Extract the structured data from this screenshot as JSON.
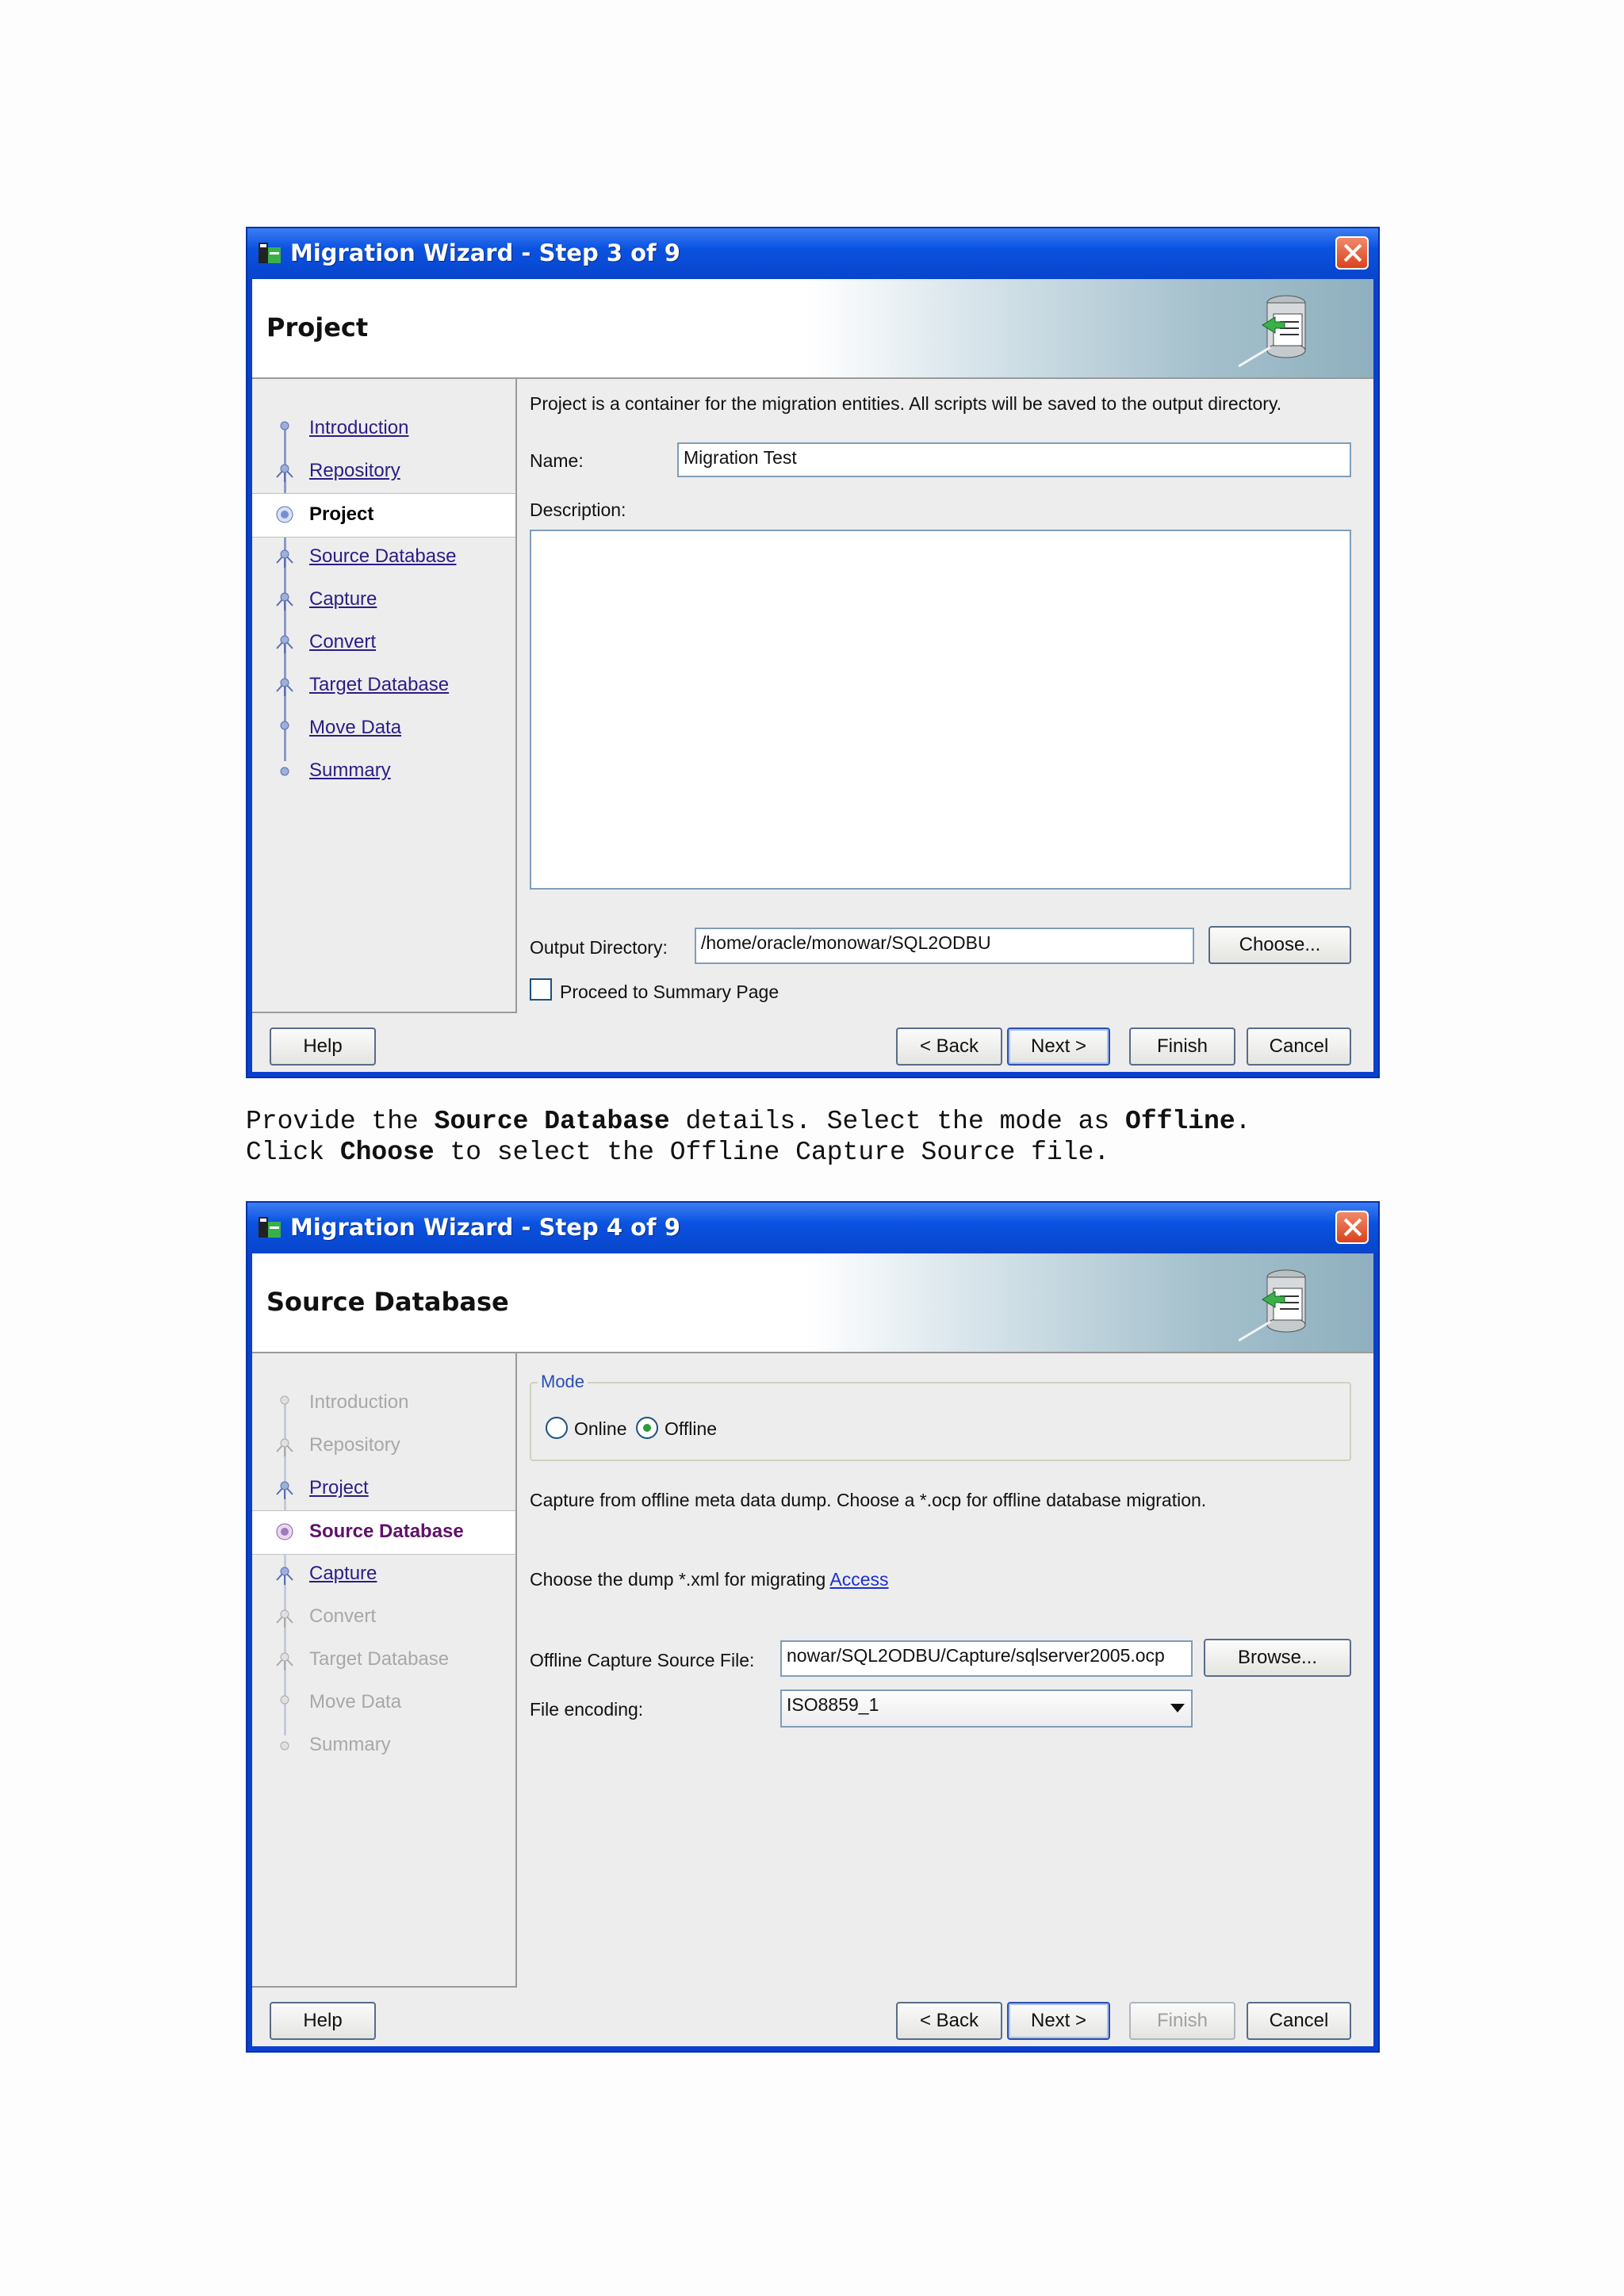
{
  "window1": {
    "title": "Migration Wizard - Step 3 of 9",
    "header_title": "Project",
    "nav": [
      "Introduction",
      "Repository",
      "Project",
      "Source Database",
      "Capture",
      "Convert",
      "Target Database",
      "Move Data",
      "Summary"
    ],
    "intro_text": "Project is a container for the migration entities.  All scripts will be saved to the output directory.",
    "name_label": "Name:",
    "name_value": "Migration Test",
    "description_label": "Description:",
    "output_label": "Output Directory:",
    "output_value": "/home/oracle/monowar/SQL2ODBU",
    "choose_button": "Choose...",
    "proceed_label": "Proceed to Summary Page",
    "buttons": {
      "help": "Help",
      "back": "< Back",
      "next": "Next >",
      "finish": "Finish",
      "cancel": "Cancel"
    }
  },
  "caption": {
    "line1_a": "Provide the ",
    "line1_b": "Source Database",
    "line1_c": " details. Select the mode as ",
    "line1_d": "Offline",
    "line1_e": ".",
    "line2_a": "Click ",
    "line2_b": "Choose",
    "line2_c": " to select the Offline Capture Source file."
  },
  "window2": {
    "title": "Migration Wizard - Step 4 of 9",
    "header_title": "Source Database",
    "nav": [
      "Introduction",
      "Repository",
      "Project",
      "Source Database",
      "Capture",
      "Convert",
      "Target Database",
      "Move Data",
      "Summary"
    ],
    "mode_legend": "Mode",
    "online_label": "Online",
    "offline_label": "Offline",
    "capture_text": "Capture from offline meta data dump.  Choose a *.ocp for offline database migration.",
    "dump_text": "Choose the dump *.xml for migrating",
    "access_link": "Access",
    "source_file_label": "Offline Capture Source File:",
    "source_file_value": "nowar/SQL2ODBU/Capture/sqlserver2005.ocp",
    "browse_button": "Browse...",
    "encoding_label": "File encoding:",
    "encoding_value": "ISO8859_1",
    "buttons": {
      "help": "Help",
      "back": "< Back",
      "next": "Next >",
      "finish": "Finish",
      "cancel": "Cancel"
    }
  },
  "colors": {
    "titlebar": "#0a52e0",
    "link": "#2a1d86",
    "current_step": "#60106a"
  }
}
